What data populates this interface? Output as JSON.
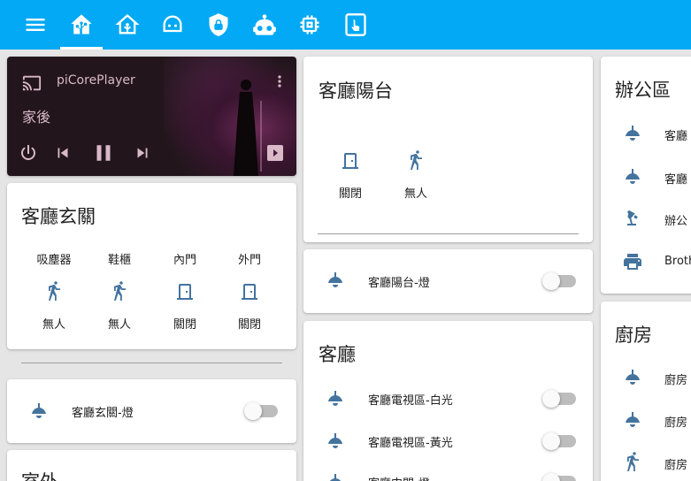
{
  "topbar": {
    "icons": [
      "menu-icon",
      "home-assistant-icon",
      "home-assistant-outline-icon",
      "robot-vacuum-icon",
      "shield-lock-icon",
      "robot-icon",
      "memory-chip-icon",
      "gesture-tap-icon"
    ]
  },
  "media_player": {
    "name": "piCorePlayer",
    "source": "家後"
  },
  "entrance": {
    "title": "客廳玄關",
    "entities": [
      {
        "label": "吸塵器",
        "state": "無人",
        "icon": "walk-icon"
      },
      {
        "label": "鞋櫃",
        "state": "無人",
        "icon": "walk-icon"
      },
      {
        "label": "內門",
        "state": "關閉",
        "icon": "door-icon"
      },
      {
        "label": "外門",
        "state": "關閉",
        "icon": "door-icon"
      }
    ],
    "light": {
      "label": "客廳玄關-燈",
      "state": "off"
    }
  },
  "outdoor": {
    "title": "室外"
  },
  "balcony": {
    "title": "客廳陽台",
    "entities": [
      {
        "state": "關閉",
        "icon": "door-icon"
      },
      {
        "state": "無人",
        "icon": "walk-icon"
      }
    ],
    "light": {
      "label": "客廳陽台-燈",
      "state": "off"
    }
  },
  "living": {
    "title": "客廳",
    "rows": [
      {
        "label": "客廳電視區-白光",
        "state": "off"
      },
      {
        "label": "客廳電視區-黃光",
        "state": "off"
      },
      {
        "label": "客廳中間-燈",
        "state": "off"
      }
    ]
  },
  "office": {
    "title": "辦公區",
    "rows": [
      {
        "label": "客廳",
        "icon": "ceiling-light-icon"
      },
      {
        "label": "客廳",
        "icon": "ceiling-light-icon"
      },
      {
        "label": "辦公",
        "icon": "desk-lamp-icon"
      },
      {
        "label": "Broth",
        "icon": "printer-icon"
      }
    ]
  },
  "kitchen": {
    "title": "廚房",
    "rows": [
      {
        "label": "廚房",
        "icon": "ceiling-light-icon"
      },
      {
        "label": "廚房",
        "icon": "ceiling-light-icon"
      },
      {
        "label": "廚房",
        "icon": "walk-icon"
      }
    ]
  },
  "colors": {
    "header": "#03a9f4",
    "icon": "#44739e",
    "background": "#e5e5e5"
  }
}
